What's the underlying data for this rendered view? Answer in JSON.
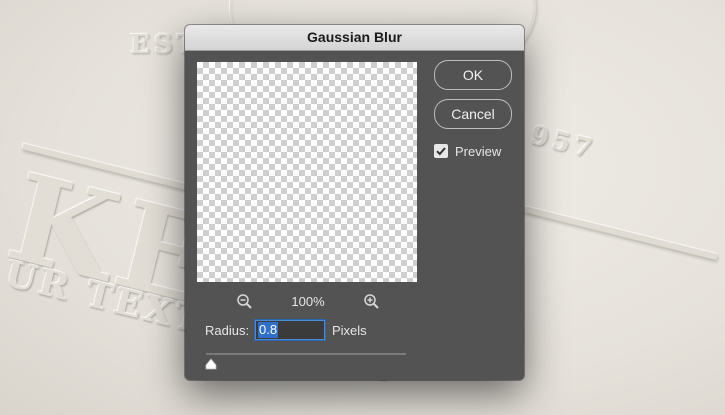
{
  "background": {
    "emboss_est": "EST",
    "emboss_year": "957",
    "emboss_name": "KE",
    "emboss_tagline": "UR TEXT HERE A"
  },
  "dialog": {
    "title": "Gaussian Blur",
    "preview_pane": "transparent-checkerboard",
    "zoom": {
      "level": "100%",
      "zoom_out_icon": "zoom-out-icon",
      "zoom_in_icon": "zoom-in-icon"
    },
    "radius": {
      "label": "Radius:",
      "value": "0.8",
      "unit": "Pixels",
      "slider_value": 0.8
    },
    "buttons": {
      "ok_label": "OK",
      "cancel_label": "Cancel"
    },
    "preview_checkbox": {
      "label": "Preview",
      "checked": true
    }
  },
  "colors": {
    "dialog_bg": "#535353",
    "titlebar_bg": "#d9d9d9",
    "input_focus": "#4d8ad6",
    "text_light": "#e6e6e6"
  }
}
